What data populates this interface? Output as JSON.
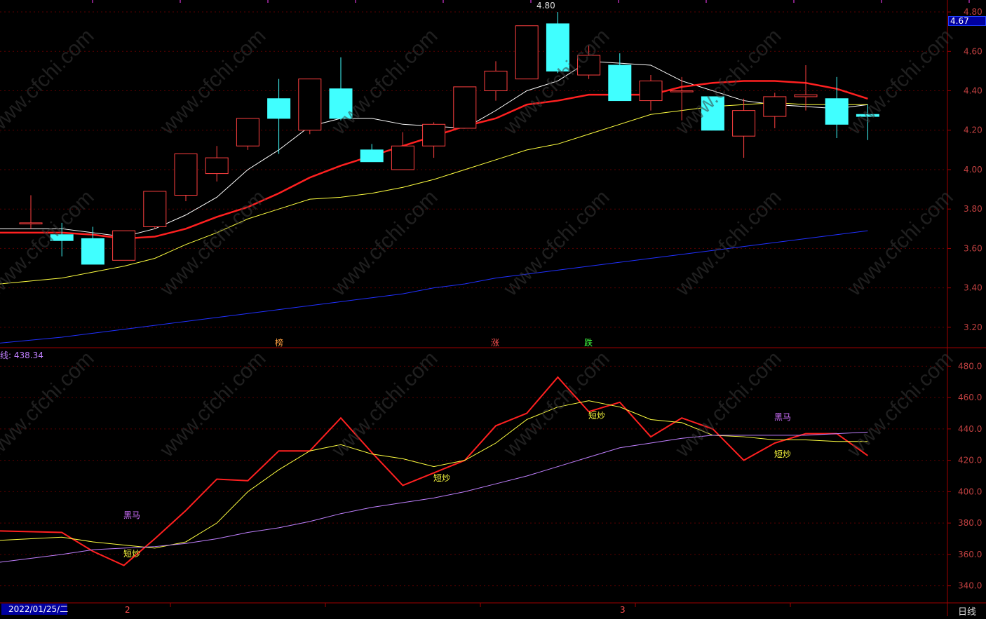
{
  "price_panel": {
    "last_price": "4.67",
    "y_ticks": [
      "4.80",
      "4.60",
      "4.40",
      "4.20",
      "4.00",
      "3.80",
      "3.60",
      "3.40",
      "3.20"
    ],
    "high_label": "4.80",
    "markers": [
      {
        "text": "榜",
        "color": "#ffa040"
      },
      {
        "text": "涨",
        "color": "#ff5050"
      },
      {
        "text": "跌",
        "color": "#40ff40"
      }
    ]
  },
  "indicator_panel": {
    "title": "线: 438.34",
    "y_ticks": [
      "480.0",
      "460.0",
      "440.0",
      "420.0",
      "400.0",
      "380.0",
      "360.0",
      "340.0"
    ],
    "signals": [
      {
        "text": "黑马",
        "color": "#d070ff"
      },
      {
        "text": "短炒",
        "color": "#ffff40"
      },
      {
        "text": "短炒",
        "color": "#ffff40"
      },
      {
        "text": "短炒",
        "color": "#ffff40"
      },
      {
        "text": "黑马",
        "color": "#d070ff"
      },
      {
        "text": "短炒",
        "color": "#ffff40"
      }
    ]
  },
  "footer": {
    "date_label": "2022/01/25/二",
    "month_marks": [
      "2",
      "3"
    ],
    "period": "日线"
  },
  "chart_data": [
    {
      "type": "candlestick",
      "ylim": [
        3.1,
        4.85
      ],
      "grid": true,
      "candles": [
        {
          "o": 3.73,
          "h": 3.87,
          "l": 3.7,
          "c": 3.73
        },
        {
          "o": 3.67,
          "h": 3.73,
          "l": 3.56,
          "c": 3.64
        },
        {
          "o": 3.65,
          "h": 3.71,
          "l": 3.52,
          "c": 3.52
        },
        {
          "o": 3.54,
          "h": 3.69,
          "l": 3.54,
          "c": 3.69
        },
        {
          "o": 3.71,
          "h": 3.89,
          "l": 3.7,
          "c": 3.89
        },
        {
          "o": 3.87,
          "h": 4.08,
          "l": 3.84,
          "c": 4.08
        },
        {
          "o": 3.98,
          "h": 4.12,
          "l": 3.94,
          "c": 4.06
        },
        {
          "o": 4.12,
          "h": 4.26,
          "l": 4.1,
          "c": 4.26
        },
        {
          "o": 4.36,
          "h": 4.46,
          "l": 4.08,
          "c": 4.26
        },
        {
          "o": 4.2,
          "h": 4.46,
          "l": 4.18,
          "c": 4.46
        },
        {
          "o": 4.41,
          "h": 4.57,
          "l": 4.25,
          "c": 4.26
        },
        {
          "o": 4.1,
          "h": 4.13,
          "l": 4.04,
          "c": 4.04
        },
        {
          "o": 4.0,
          "h": 4.19,
          "l": 4.0,
          "c": 4.12
        },
        {
          "o": 4.12,
          "h": 4.24,
          "l": 4.06,
          "c": 4.23
        },
        {
          "o": 4.21,
          "h": 4.42,
          "l": 4.21,
          "c": 4.42
        },
        {
          "o": 4.4,
          "h": 4.55,
          "l": 4.35,
          "c": 4.5
        },
        {
          "o": 4.46,
          "h": 4.73,
          "l": 4.46,
          "c": 4.73
        },
        {
          "o": 4.74,
          "h": 4.8,
          "l": 4.49,
          "c": 4.5
        },
        {
          "o": 4.48,
          "h": 4.63,
          "l": 4.46,
          "c": 4.58
        },
        {
          "o": 4.53,
          "h": 4.59,
          "l": 4.35,
          "c": 4.35
        },
        {
          "o": 4.35,
          "h": 4.48,
          "l": 4.3,
          "c": 4.45
        },
        {
          "o": 4.4,
          "h": 4.47,
          "l": 4.25,
          "c": 4.4
        },
        {
          "o": 4.37,
          "h": 4.37,
          "l": 4.2,
          "c": 4.2
        },
        {
          "o": 4.17,
          "h": 4.36,
          "l": 4.06,
          "c": 4.3
        },
        {
          "o": 4.27,
          "h": 4.39,
          "l": 4.21,
          "c": 4.37
        },
        {
          "o": 4.37,
          "h": 4.53,
          "l": 4.3,
          "c": 4.38
        },
        {
          "o": 4.36,
          "h": 4.47,
          "l": 4.16,
          "c": 4.23
        },
        {
          "o": 4.28,
          "h": 4.33,
          "l": 4.15,
          "c": 4.27
        }
      ],
      "series": [
        {
          "color": "#ffffff",
          "values": [
            3.7,
            3.7,
            3.68,
            3.66,
            3.7,
            3.77,
            3.86,
            4.0,
            4.1,
            4.22,
            4.26,
            4.26,
            4.23,
            4.22,
            4.21,
            4.3,
            4.4,
            4.45,
            4.55,
            4.54,
            4.53,
            4.45,
            4.4,
            4.35,
            4.33,
            4.32,
            4.31,
            4.33
          ]
        },
        {
          "color": "#ff2020",
          "values": [
            3.68,
            3.68,
            3.67,
            3.65,
            3.66,
            3.7,
            3.76,
            3.81,
            3.88,
            3.96,
            4.02,
            4.07,
            4.12,
            4.17,
            4.22,
            4.26,
            4.33,
            4.35,
            4.38,
            4.38,
            4.38,
            4.42,
            4.44,
            4.45,
            4.45,
            4.44,
            4.41,
            4.36
          ]
        },
        {
          "color": "#ffff40",
          "values": [
            3.42,
            3.45,
            3.48,
            3.51,
            3.55,
            3.62,
            3.68,
            3.75,
            3.8,
            3.85,
            3.86,
            3.88,
            3.91,
            3.95,
            4.0,
            4.05,
            4.1,
            4.13,
            4.18,
            4.23,
            4.28,
            4.3,
            4.32,
            4.33,
            4.34,
            4.33,
            4.33,
            4.33
          ]
        },
        {
          "color": "#2030ff",
          "values": [
            3.12,
            3.15,
            3.17,
            3.19,
            3.21,
            3.23,
            3.25,
            3.27,
            3.29,
            3.31,
            3.33,
            3.35,
            3.37,
            3.4,
            3.42,
            3.45,
            3.47,
            3.49,
            3.51,
            3.53,
            3.55,
            3.57,
            3.59,
            3.61,
            3.63,
            3.65,
            3.67,
            3.69
          ]
        }
      ]
    },
    {
      "type": "line",
      "ylim": [
        330,
        490
      ],
      "grid": true,
      "series": [
        {
          "color": "#ff2020",
          "values": [
            375,
            374,
            362,
            353,
            370,
            388,
            408,
            407,
            426,
            426,
            447,
            425,
            404,
            412,
            420,
            442,
            450,
            473,
            451,
            457,
            435,
            447,
            440,
            420,
            431,
            437,
            437,
            423
          ]
        },
        {
          "color": "#ffff40",
          "values": [
            369,
            371,
            368,
            366,
            364,
            368,
            380,
            400,
            414,
            426,
            430,
            424,
            421,
            416,
            420,
            431,
            446,
            454,
            458,
            454,
            446,
            444,
            436,
            435,
            433,
            433,
            432,
            432
          ]
        },
        {
          "color": "#c080ff",
          "values": [
            355,
            360,
            363,
            364,
            365,
            367,
            370,
            374,
            377,
            381,
            386,
            390,
            393,
            396,
            400,
            405,
            410,
            416,
            422,
            428,
            431,
            434,
            436,
            436,
            436,
            436,
            437,
            438
          ]
        }
      ]
    }
  ]
}
